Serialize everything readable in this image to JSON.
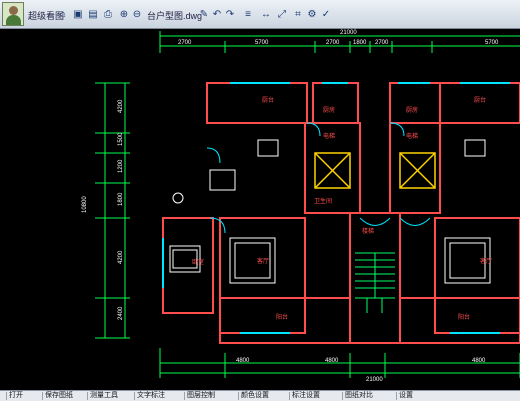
{
  "topbar": {
    "title_left": "超级看图",
    "file_name": "台户型图.dwg",
    "icons": [
      "home-icon",
      "open-icon",
      "save-icon",
      "print-icon",
      "zoom-in-icon",
      "zoom-out-icon",
      "zoom-window-icon",
      "pan-icon",
      "rotate-icon",
      "undo-icon",
      "redo-icon",
      "pen-icon",
      "text-icon",
      "measure-icon",
      "layer-icon",
      "ruler-icon",
      "settings-icon",
      "full-screen-icon",
      "help-icon"
    ]
  },
  "drawing": {
    "dims_top_total": "21000",
    "dims_top_segments": [
      "2700",
      "5700",
      "2700",
      "1800",
      "2700",
      "5700"
    ],
    "dims_bottom_total": "21000",
    "dims_bottom_segments": [
      "4800",
      "4800",
      "4800"
    ],
    "dims_left_total": "10800",
    "dims_left_segments": [
      "4200",
      "1500",
      "1200",
      "1800",
      "4200",
      "2400"
    ],
    "rooms": [
      "厨台",
      "厨房",
      "厨房",
      "厨台",
      "客厅",
      "客厅",
      "卧室",
      "阳台",
      "阳台",
      "卫生间",
      "电梯",
      "电梯",
      "楼梯"
    ]
  },
  "bottombar": {
    "buttons": [
      "打开",
      "保存图纸",
      "测量工具",
      "文字标注",
      "图层控制",
      "颜色设置",
      "标注设置",
      "图纸对比",
      "设置"
    ]
  },
  "colors": {
    "wall": "#ff4d4d",
    "window": "#00e5ff",
    "door": "#00e5ff",
    "dim": "#00ff4c",
    "furniture": "#ffffff",
    "elevator": "#ffd200",
    "stairs": "#00ff66"
  }
}
